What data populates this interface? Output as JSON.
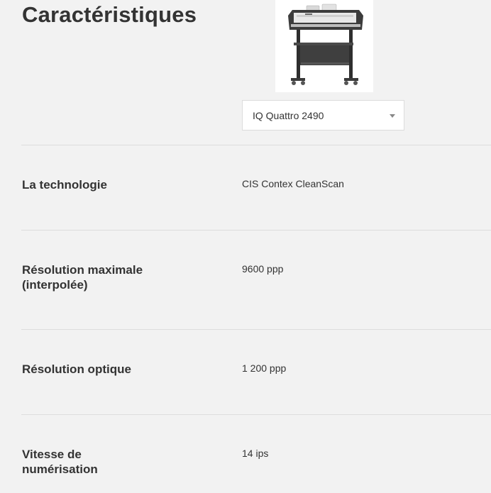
{
  "page": {
    "title": "Caractéristiques"
  },
  "product": {
    "image_name": "large-format-scanner-on-stand",
    "selected_model": "IQ Quattro 2490"
  },
  "specs": [
    {
      "label": "La technologie",
      "value": "CIS Contex CleanScan"
    },
    {
      "label": "Résolution maximale (interpolée)",
      "value": "9600 ppp"
    },
    {
      "label": "Résolution optique",
      "value": "1 200 ppp"
    },
    {
      "label": "Vitesse de numérisation",
      "value": "14 ips"
    }
  ],
  "colors": {
    "background": "#f2f2f2",
    "text": "#333333",
    "divider": "#dddddd"
  }
}
